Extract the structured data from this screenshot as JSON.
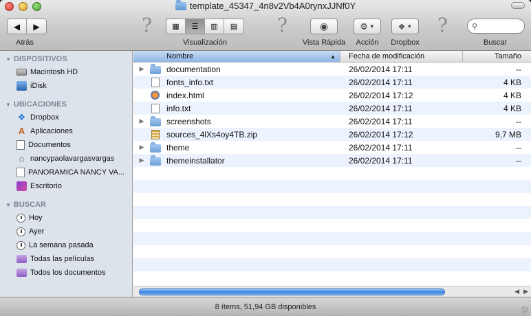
{
  "window": {
    "title": "template_45347_4n8v2Vb4A0rynxJJNf0Y"
  },
  "toolbar": {
    "back_label": "Atrás",
    "view_label": "Visualización",
    "quicklook_label": "Vista Rápida",
    "action_label": "Acción",
    "dropbox_label": "Dropbox",
    "search_label": "Buscar",
    "search_placeholder": "",
    "active_view": "list"
  },
  "sidebar": {
    "sections": [
      {
        "header": "DISPOSITIVOS",
        "items": [
          {
            "label": "Macintosh HD",
            "icon": "hard-drive-icon"
          },
          {
            "label": "iDisk",
            "icon": "idisk-icon"
          }
        ]
      },
      {
        "header": "UBICACIONES",
        "items": [
          {
            "label": "Dropbox",
            "icon": "dropbox-icon"
          },
          {
            "label": "Aplicaciones",
            "icon": "applications-icon"
          },
          {
            "label": "Documentos",
            "icon": "documents-icon"
          },
          {
            "label": "nancypaolavargasvargas",
            "icon": "home-icon"
          },
          {
            "label": "PANORAMICA NANCY VA...",
            "icon": "document-icon"
          },
          {
            "label": "Escritorio",
            "icon": "desktop-icon"
          }
        ]
      },
      {
        "header": "BUSCAR",
        "items": [
          {
            "label": "Hoy",
            "icon": "clock-icon"
          },
          {
            "label": "Ayer",
            "icon": "clock-icon"
          },
          {
            "label": "La semana pasada",
            "icon": "clock-icon"
          },
          {
            "label": "Todas las películas",
            "icon": "smart-folder-icon"
          },
          {
            "label": "Todos los documentos",
            "icon": "smart-folder-icon"
          }
        ]
      }
    ]
  },
  "list": {
    "columns": {
      "name": "Nombre",
      "date": "Fecha de modificación",
      "size": "Tamaño"
    },
    "rows": [
      {
        "name": "documentation",
        "date": "26/02/2014 17:11",
        "size": "--",
        "kind": "folder"
      },
      {
        "name": "fonts_info.txt",
        "date": "26/02/2014 17:11",
        "size": "4 KB",
        "kind": "txt"
      },
      {
        "name": "index.html",
        "date": "26/02/2014 17:12",
        "size": "4 KB",
        "kind": "html"
      },
      {
        "name": "info.txt",
        "date": "26/02/2014 17:11",
        "size": "4 KB",
        "kind": "txt"
      },
      {
        "name": "screenshots",
        "date": "26/02/2014 17:11",
        "size": "--",
        "kind": "folder"
      },
      {
        "name": "sources_4lXs4oy4TB.zip",
        "date": "26/02/2014 17:12",
        "size": "9,7 MB",
        "kind": "zip"
      },
      {
        "name": "theme",
        "date": "26/02/2014 17:11",
        "size": "--",
        "kind": "folder"
      },
      {
        "name": "themeinstallator",
        "date": "26/02/2014 17:11",
        "size": "--",
        "kind": "folder"
      }
    ]
  },
  "status": {
    "text": "8 ítems, 51,94 GB disponibles"
  }
}
